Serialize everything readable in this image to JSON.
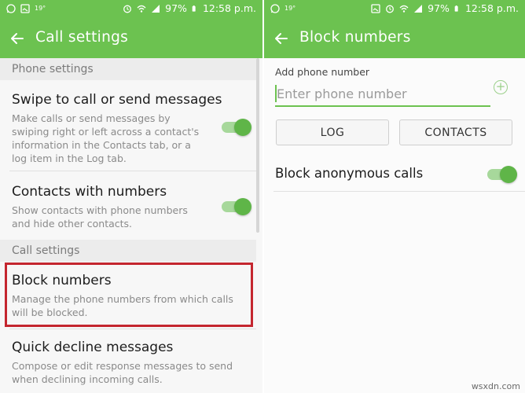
{
  "status_bar": {
    "battery_percent": "97%",
    "time": "12:58 p.m.",
    "small_badge": "19°",
    "icons": [
      "whatsapp-icon",
      "gallery-icon",
      "alarm-icon",
      "wifi-icon",
      "signal-icon",
      "battery-icon"
    ]
  },
  "left": {
    "title": "Call settings",
    "sections": [
      {
        "header": "Phone settings"
      },
      {
        "header": "Call settings"
      }
    ],
    "items": [
      {
        "title": "Swipe to call or send messages",
        "desc": "Make calls or send messages by swiping right or left across a contact's information in the Contacts tab, or a log item in the Log tab.",
        "toggle": true
      },
      {
        "title": "Contacts with numbers",
        "desc": "Show contacts with phone numbers and hide other contacts.",
        "toggle": true
      },
      {
        "title": "Block numbers",
        "desc": "Manage the phone numbers from which calls will be blocked."
      },
      {
        "title": "Quick decline messages",
        "desc": "Compose or edit response messages to send when declining incoming calls."
      }
    ]
  },
  "right": {
    "title": "Block numbers",
    "field_label": "Add phone number",
    "input_placeholder": "Enter phone number",
    "input_value": "",
    "log_button": "LOG",
    "contacts_button": "CONTACTS",
    "anonymous_label": "Block anonymous calls",
    "anonymous_toggle": true
  },
  "colors": {
    "accent": "#6cc250",
    "highlight": "#c4262f"
  },
  "watermark": "wsxdn.com"
}
